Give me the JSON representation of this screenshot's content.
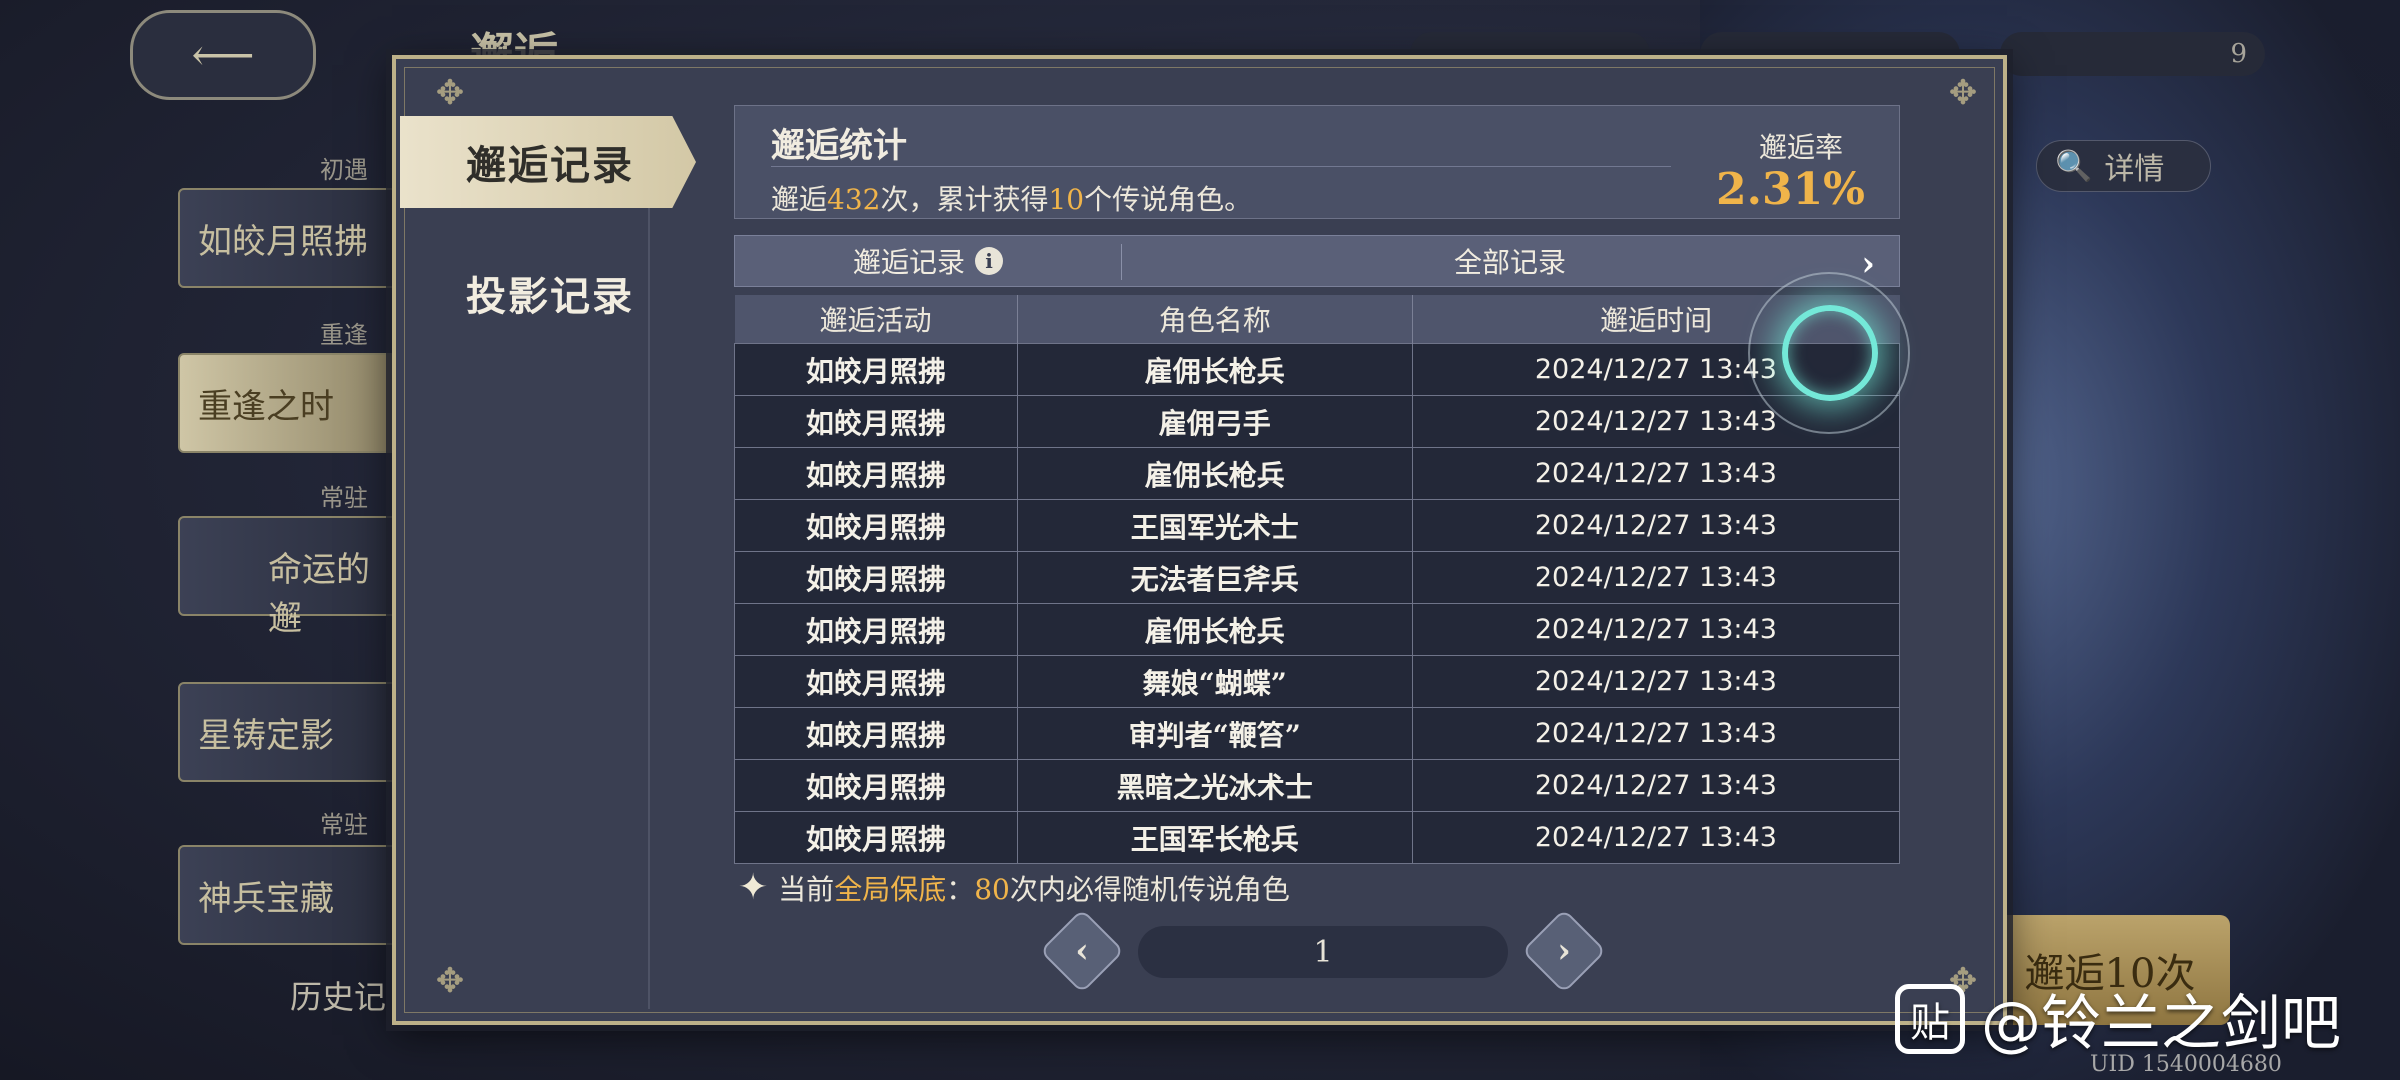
{
  "background": {
    "title": "邂逅",
    "cards": [
      {
        "tag": "初遇",
        "label": "如皎月照拂"
      },
      {
        "tag": "重逢",
        "label": "重逢之时"
      },
      {
        "tag": "常驻",
        "label": "命运的邂"
      },
      {
        "tag": "",
        "label": "星铸定影"
      },
      {
        "tag": "常驻",
        "label": "神兵宝藏"
      }
    ],
    "history_label": "历史记",
    "counter_value": "9",
    "details_label": "详情",
    "summon10_label": "邂逅10次"
  },
  "tabs": {
    "active": "邂逅记录",
    "inactive": "投影记录"
  },
  "stats": {
    "title": "邂逅统计",
    "sub_prefix": "邂逅",
    "count": "432",
    "sub_mid": "次，累计获得",
    "legend_count": "10",
    "sub_suffix": "个传说角色。",
    "rate_label": "邂逅率",
    "rate_value": "2.31%"
  },
  "filter": {
    "left_label": "邂逅记录",
    "right_label": "全部记录"
  },
  "table": {
    "headers": [
      "邂逅活动",
      "角色名称",
      "邂逅时间"
    ],
    "rows": [
      [
        "如皎月照拂",
        "雇佣长枪兵",
        "2024/12/27 13:43"
      ],
      [
        "如皎月照拂",
        "雇佣弓手",
        "2024/12/27 13:43"
      ],
      [
        "如皎月照拂",
        "雇佣长枪兵",
        "2024/12/27 13:43"
      ],
      [
        "如皎月照拂",
        "王国军光术士",
        "2024/12/27 13:43"
      ],
      [
        "如皎月照拂",
        "无法者巨斧兵",
        "2024/12/27 13:43"
      ],
      [
        "如皎月照拂",
        "雇佣长枪兵",
        "2024/12/27 13:43"
      ],
      [
        "如皎月照拂",
        "舞娘“蝴蝶”",
        "2024/12/27 13:43"
      ],
      [
        "如皎月照拂",
        "审判者“鞭笞”",
        "2024/12/27 13:43"
      ],
      [
        "如皎月照拂",
        "黑暗之光冰术士",
        "2024/12/27 13:43"
      ],
      [
        "如皎月照拂",
        "王国军长枪兵",
        "2024/12/27 13:43"
      ]
    ]
  },
  "pity": {
    "prefix": "当前",
    "highlight": "全局保底",
    "colon": "：",
    "count": "80",
    "suffix": "次内必得随机传说角色"
  },
  "pager": {
    "page": "1"
  },
  "watermark": {
    "logo": "贴",
    "text": "@铃兰之剑吧",
    "uid": "UID 1540004680"
  },
  "colors": {
    "accent_gold": "#f0b44a",
    "frame_gold": "#bdb189",
    "modal_bg": "#3a3f52"
  }
}
